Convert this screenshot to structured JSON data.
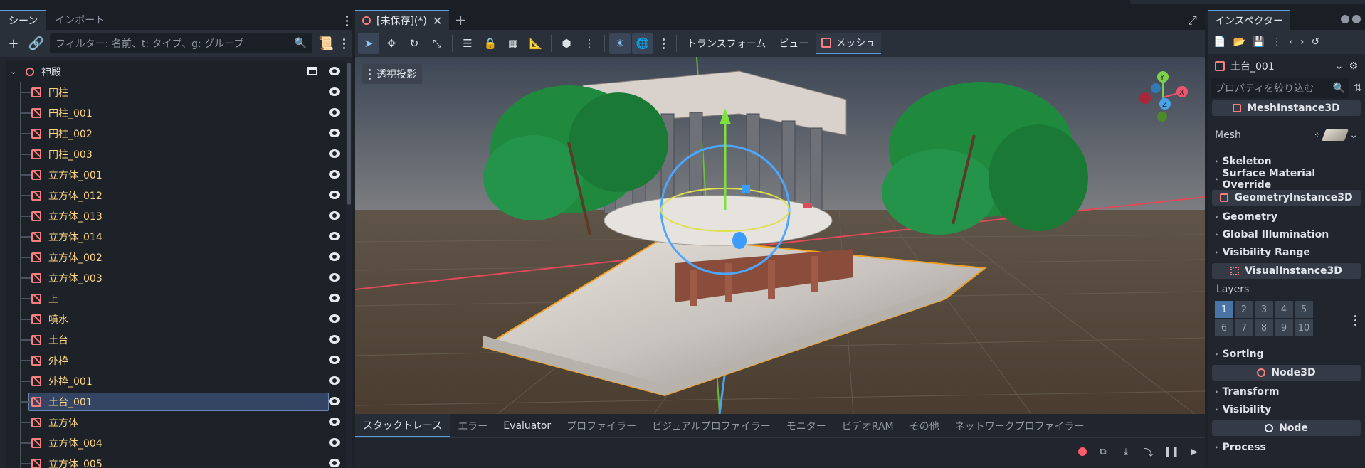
{
  "left_dock": {
    "tabs": [
      "シーン",
      "インポート"
    ],
    "filter_placeholder": "フィルター: 名前、t: タイプ、g: グループ",
    "tree": {
      "root": "神殿",
      "items": [
        "円柱",
        "円柱_001",
        "円柱_002",
        "円柱_003",
        "立方体_001",
        "立方体_012",
        "立方体_013",
        "立方体_014",
        "立方体_002",
        "立方体_003",
        "上",
        "噴水",
        "土台",
        "外枠",
        "外枠_001",
        "土台_001",
        "立方体",
        "立方体_004",
        "立方体_005"
      ],
      "selected": "土台_001"
    }
  },
  "center": {
    "scene_tab": "[未保存](*)",
    "toolbar_menus": [
      "トランスフォーム",
      "ビュー",
      "メッシュ"
    ],
    "perspective_button": "透視投影",
    "gizmo_axes": [
      "Y",
      "X",
      "Z"
    ],
    "bottom_tabs": [
      "スタックトレース",
      "エラー",
      "Evaluator",
      "プロファイラー",
      "ビジュアルプロファイラー",
      "モニター",
      "ビデオRAM",
      "その他",
      "ネットワークプロファイラー"
    ],
    "bottom_active": "スタックトレース"
  },
  "inspector": {
    "tab": "インスペクター",
    "node_name": "土台_001",
    "filter_placeholder": "プロパティを絞り込む",
    "sections": {
      "mesh_instance": "MeshInstance3D",
      "mesh_label": "Mesh",
      "geometry_instance": "GeometryInstance3D",
      "visual_instance": "VisualInstance3D",
      "node3d": "Node3D",
      "node": "Node"
    },
    "categories_a": [
      "Skeleton",
      "Surface Material Override"
    ],
    "categories_b": [
      "Geometry",
      "Global Illumination",
      "Visibility Range"
    ],
    "layers_label": "Layers",
    "layers": [
      "1",
      "2",
      "3",
      "4",
      "5",
      "6",
      "7",
      "8",
      "9",
      "10"
    ],
    "categories_c": [
      "Sorting"
    ],
    "categories_d": [
      "Transform",
      "Visibility"
    ],
    "categories_e": [
      "Process"
    ]
  },
  "colors": {
    "accent": "#5d9ddb",
    "node_icon": "#fc7f7f",
    "tree_text": "#ffd684",
    "selection": "#334563"
  }
}
